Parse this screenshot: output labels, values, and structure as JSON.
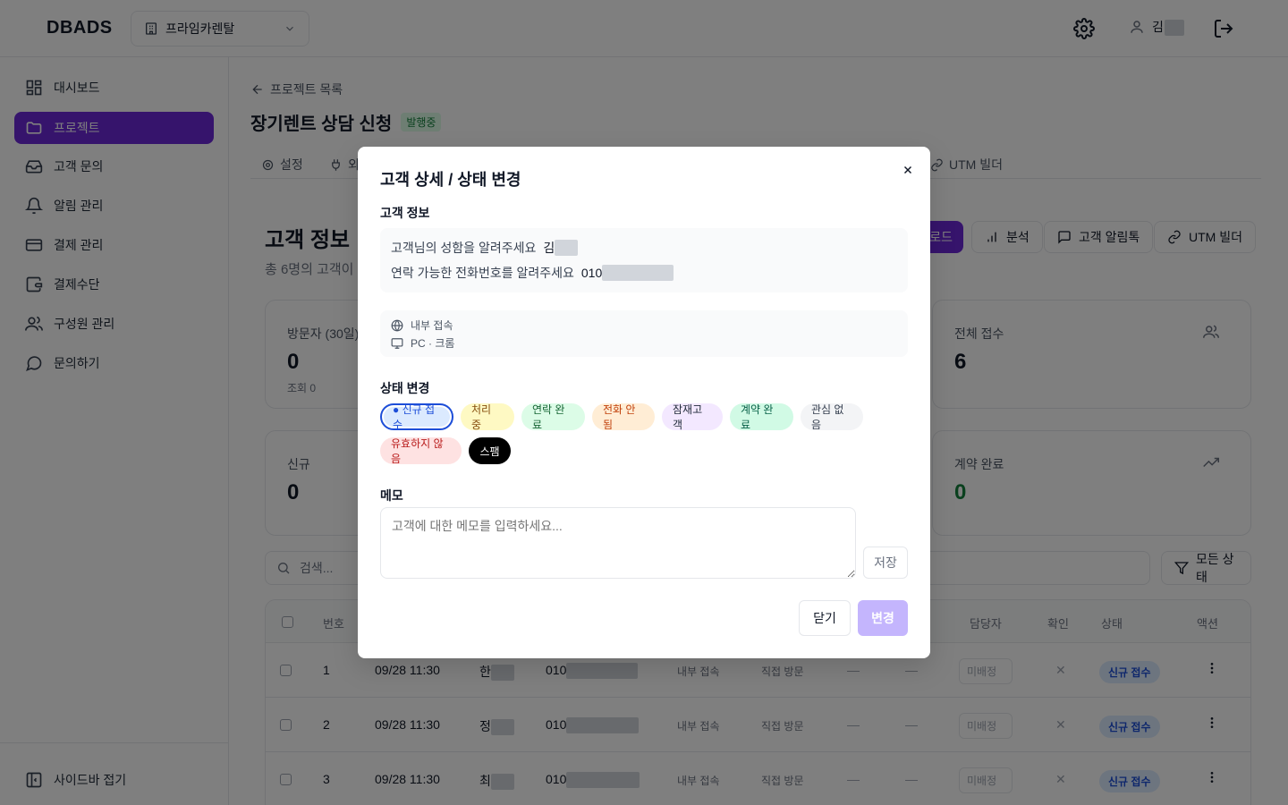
{
  "app": {
    "logo": "DBADS"
  },
  "header": {
    "org_name": "프라임카렌탈",
    "user_initial": "김"
  },
  "sidebar": {
    "items": [
      {
        "label": "대시보드",
        "icon": "dashboard-icon"
      },
      {
        "label": "프로젝트",
        "icon": "folder-icon"
      },
      {
        "label": "고객 문의",
        "icon": "inbox-icon"
      },
      {
        "label": "알림 관리",
        "icon": "bell-icon"
      },
      {
        "label": "결제 관리",
        "icon": "credit-card-icon"
      },
      {
        "label": "결제수단",
        "icon": "wallet-icon"
      },
      {
        "label": "구성원 관리",
        "icon": "users-icon"
      },
      {
        "label": "문의하기",
        "icon": "chat-icon"
      }
    ],
    "collapse_label": "사이드바 접기"
  },
  "page": {
    "back_label": "프로젝트 목록",
    "title": "장기렌트 상담 신청",
    "status_badge": "발행중",
    "tabs": [
      "설정",
      "외",
      "UTM 빌더"
    ],
    "section_title": "고객 정보",
    "section_sub": "총 6명의 고객이",
    "buttons": {
      "download": "로드",
      "analysis": "분석",
      "alimtalk": "고객 알림톡",
      "utm": "UTM 빌더"
    },
    "cards": {
      "visitors_label": "방문자 (30일)",
      "visitors_value": "0",
      "visitors_note": "조회 0",
      "total_label": "전체 접수",
      "total_value": "6",
      "new_label": "신규",
      "new_value": "0",
      "contract_label": "계약 완료",
      "contract_value": "0"
    },
    "search_placeholder": "검색...",
    "filter_label": "모든 상태",
    "table": {
      "headers": {
        "no": "번호",
        "assignee": "담당자",
        "confirm": "확인",
        "status": "상태",
        "action": "액션"
      },
      "rows": [
        {
          "no": "1",
          "date": "09/28 11:30",
          "name_initial": "한",
          "phone_prefix": "010",
          "source": "내부 접속",
          "channel": "직접 방문",
          "dash1": "—",
          "dash2": "—",
          "assignee": "미배정",
          "status": "신규 접수"
        },
        {
          "no": "2",
          "date": "09/28 11:30",
          "name_initial": "정",
          "phone_prefix": "010",
          "source": "내부 접속",
          "channel": "직접 방문",
          "dash1": "—",
          "dash2": "—",
          "assignee": "미배정",
          "status": "신규 접수"
        },
        {
          "no": "3",
          "date": "09/28 11:30",
          "name_initial": "최",
          "phone_prefix": "010",
          "source": "내부 접속",
          "channel": "직접 방문",
          "dash1": "—",
          "dash2": "—",
          "assignee": "미배정",
          "status": "신규 접수"
        }
      ]
    }
  },
  "modal": {
    "title": "고객 상세 / 상태 변경",
    "customer_info_label": "고객 정보",
    "name_question": "고객님의 성함을 알려주세요",
    "name_value": "김",
    "phone_question": "연락 가능한 전화번호를 알려주세요",
    "phone_value": "010",
    "source": "내부 접속",
    "device": "PC · 크롬",
    "status_change_label": "상태 변경",
    "statuses": [
      {
        "label": "● 신규 접수",
        "bg": "#dbeafe",
        "fg": "#1d4ed8",
        "selected": true
      },
      {
        "label": "처리 중",
        "bg": "#fef9c3",
        "fg": "#854d0e"
      },
      {
        "label": "연락 완료",
        "bg": "#dcfce7",
        "fg": "#166534"
      },
      {
        "label": "전화 안됨",
        "bg": "#ffedd5",
        "fg": "#c2410c"
      },
      {
        "label": "잠재고객",
        "bg": "#f3e8ff",
        "fg": "#1f2937"
      },
      {
        "label": "계약 완료",
        "bg": "#d1fae5",
        "fg": "#065f46"
      },
      {
        "label": "관심 없음",
        "bg": "#f3f4f6",
        "fg": "#374151"
      },
      {
        "label": "유효하지 않음",
        "bg": "#fee2e2",
        "fg": "#b91c1c"
      },
      {
        "label": "스팸",
        "bg": "#000000",
        "fg": "#ffffff"
      }
    ],
    "memo_label": "메모",
    "memo_placeholder": "고객에 대한 메모를 입력하세요...",
    "save_label": "저장",
    "close_label": "닫기",
    "change_label": "변경"
  },
  "colors": {
    "brand": "#6d28d9",
    "change_disabled": "#c4b5fd"
  }
}
